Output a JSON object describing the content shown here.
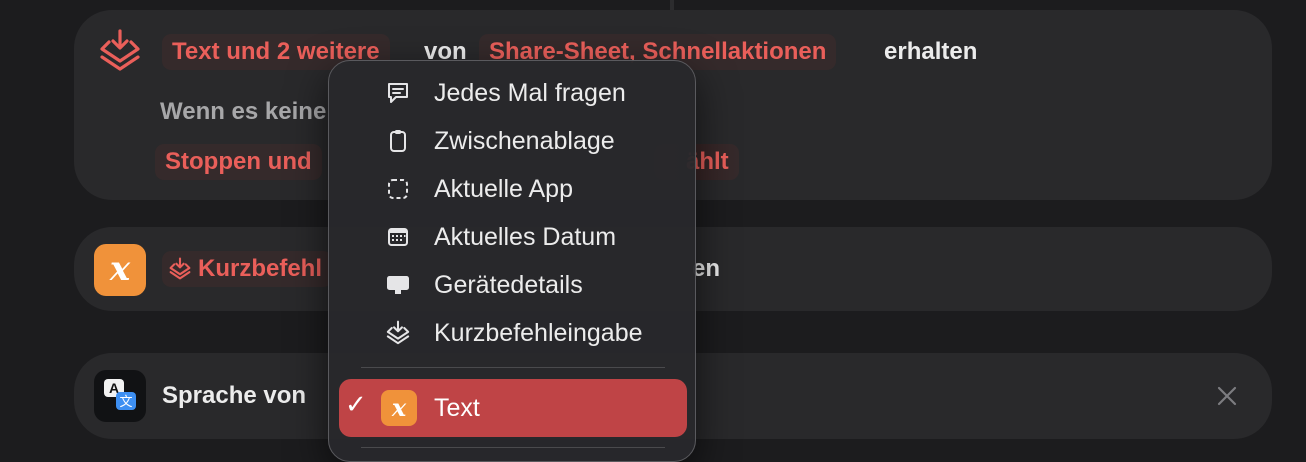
{
  "card1": {
    "action_icon": "shortcut-input-icon",
    "chip_input": "Text und 2 weitere",
    "word_from": "von",
    "chip_source": "Share-Sheet, Schnellaktionen",
    "word_receive": "erhalten",
    "fallback_text": "Wenn es keine",
    "chip_stop": "Stoppen und",
    "chip_chosen": "ählt"
  },
  "card2": {
    "icon": "text-variable-icon",
    "icon_glyph": "x",
    "chip_variable": "Kurzbefehl",
    "chip_variable_icon": "shortcut-input-icon",
    "trailing_text": "en"
  },
  "card3": {
    "icon": "translate-icon",
    "label": "Sprache von",
    "close_icon": "close-icon"
  },
  "menu": {
    "items": [
      {
        "label": "Jedes Mal fragen",
        "icon": "speech-bubble-icon"
      },
      {
        "label": "Zwischenablage",
        "icon": "clipboard-icon"
      },
      {
        "label": "Aktuelle App",
        "icon": "dashed-square-icon"
      },
      {
        "label": "Aktuelles Datum",
        "icon": "calendar-icon"
      },
      {
        "label": "Gerätedetails",
        "icon": "desktop-icon"
      },
      {
        "label": "Kurzbefehleingabe",
        "icon": "shortcut-input-icon"
      }
    ],
    "selected": {
      "label": "Text",
      "icon": "text-variable-icon",
      "glyph": "x",
      "check": "✓"
    }
  },
  "colors": {
    "accent_red": "#ea5f5a",
    "selected_bg": "#bf4446",
    "orange": "#f0923a",
    "card_bg": "#29292b",
    "page_bg": "#1c1c1e"
  }
}
